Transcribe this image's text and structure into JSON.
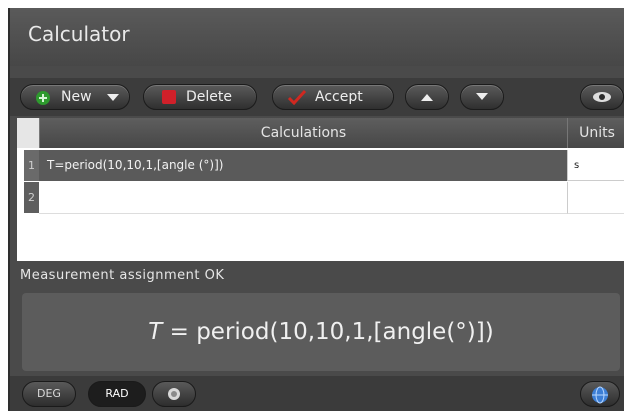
{
  "window": {
    "title": "Calculator"
  },
  "toolbar": {
    "new_label": "New",
    "delete_label": "Delete",
    "accept_label": "Accept"
  },
  "table": {
    "columns": [
      "Calculations",
      "Units"
    ],
    "rows": [
      {
        "number": "1",
        "expression": "T=period(10,10,1,[angle (°)])",
        "unit": "s"
      },
      {
        "number": "2",
        "expression": "",
        "unit": ""
      }
    ]
  },
  "status": "Measurement assignment OK",
  "preview": {
    "lhs": "T",
    "rhs": " = period(10,10,1,[angle(°)])"
  },
  "bottom": {
    "deg_label": "DEG",
    "rad_label": "RAD",
    "selected_mode": "RAD"
  },
  "icons": {
    "new": "plus-icon",
    "delete": "delete-icon",
    "accept": "checkmark-icon",
    "up": "up-arrow-icon",
    "down": "down-arrow-icon",
    "view": "eye-icon",
    "camera": "camera-icon",
    "globe": "globe-icon"
  },
  "colors": {
    "new_icon": "#2e9a2e",
    "delete_icon": "#d0202a",
    "accept_icon": "#d02820"
  }
}
